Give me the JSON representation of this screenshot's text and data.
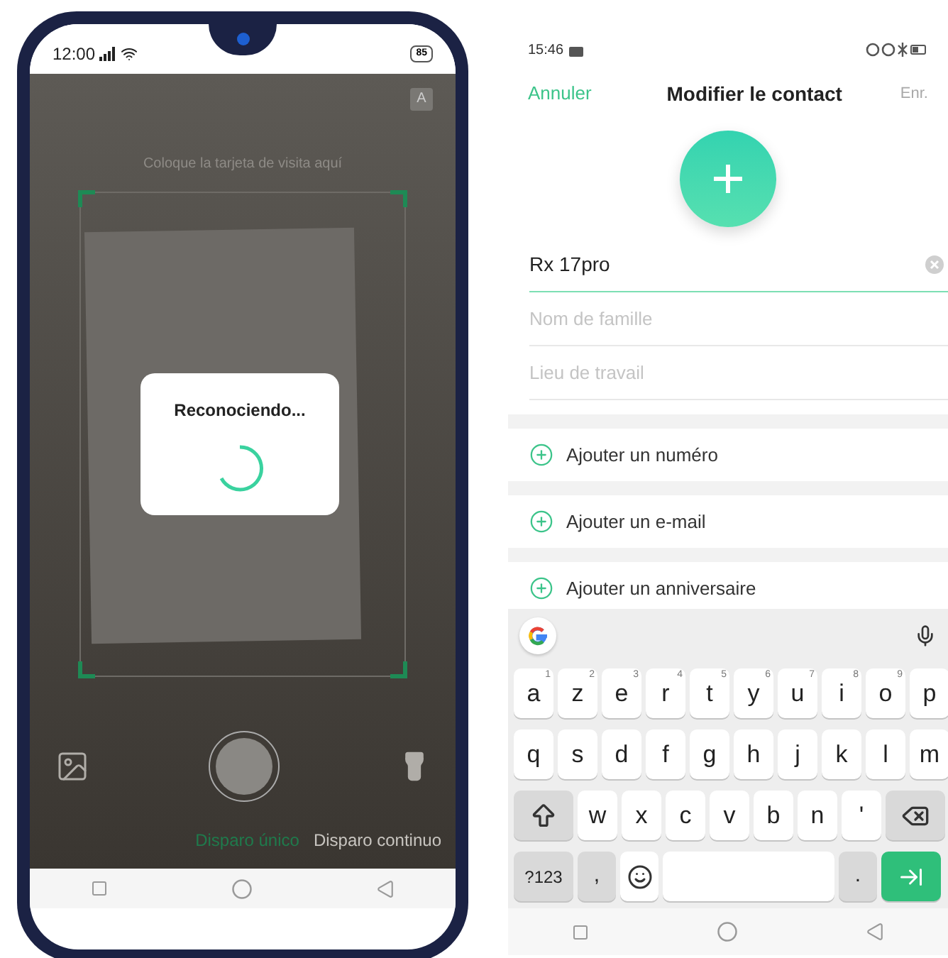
{
  "camera_phone": {
    "status_bar": {
      "time": "12:00",
      "battery": "85"
    },
    "auto_button": "A",
    "hint": "Coloque la tarjeta de visita aquí",
    "dialog": {
      "title": "Reconociendo..."
    },
    "shot_modes": [
      {
        "label": "Disparo único",
        "selected": true
      },
      {
        "label": "Disparo continuo",
        "selected": false
      }
    ]
  },
  "contact_screen": {
    "status_bar": {
      "time": "15:46"
    },
    "header": {
      "cancel": "Annuler",
      "title": "Modifier le contact",
      "save": "Enr.",
      "save_disabled": true
    },
    "name_field": {
      "value": "Rx 17pro"
    },
    "fields": [
      {
        "placeholder": "Nom de famille"
      },
      {
        "placeholder": "Lieu de travail"
      }
    ],
    "add_actions": [
      "Ajouter un numéro",
      "Ajouter un e-mail",
      "Ajouter un anniversaire"
    ],
    "keyboard": {
      "rows": [
        [
          {
            "kind": "letter",
            "label": "a",
            "hint": "1"
          },
          {
            "kind": "letter",
            "label": "z",
            "hint": "2"
          },
          {
            "kind": "letter",
            "label": "e",
            "hint": "3"
          },
          {
            "kind": "letter",
            "label": "r",
            "hint": "4"
          },
          {
            "kind": "letter",
            "label": "t",
            "hint": "5"
          },
          {
            "kind": "letter",
            "label": "y",
            "hint": "6"
          },
          {
            "kind": "letter",
            "label": "u",
            "hint": "7"
          },
          {
            "kind": "letter",
            "label": "i",
            "hint": "8"
          },
          {
            "kind": "letter",
            "label": "o",
            "hint": "9"
          },
          {
            "kind": "letter",
            "label": "p"
          }
        ],
        [
          {
            "kind": "letter",
            "label": "q"
          },
          {
            "kind": "letter",
            "label": "s"
          },
          {
            "kind": "letter",
            "label": "d"
          },
          {
            "kind": "letter",
            "label": "f"
          },
          {
            "kind": "letter",
            "label": "g"
          },
          {
            "kind": "letter",
            "label": "h"
          },
          {
            "kind": "letter",
            "label": "j"
          },
          {
            "kind": "letter",
            "label": "k"
          },
          {
            "kind": "letter",
            "label": "l"
          },
          {
            "kind": "letter",
            "label": "m"
          }
        ],
        [
          {
            "kind": "shift"
          },
          {
            "kind": "letter",
            "label": "w"
          },
          {
            "kind": "letter",
            "label": "x"
          },
          {
            "kind": "letter",
            "label": "c"
          },
          {
            "kind": "letter",
            "label": "v"
          },
          {
            "kind": "letter",
            "label": "b"
          },
          {
            "kind": "letter",
            "label": "n"
          },
          {
            "kind": "letter",
            "label": "'"
          },
          {
            "kind": "backspace"
          }
        ],
        [
          {
            "kind": "function",
            "label": "?123"
          },
          {
            "kind": "function",
            "label": ","
          },
          {
            "kind": "emoji"
          },
          {
            "kind": "space"
          },
          {
            "kind": "function",
            "label": "."
          },
          {
            "kind": "enter"
          }
        ]
      ]
    }
  }
}
